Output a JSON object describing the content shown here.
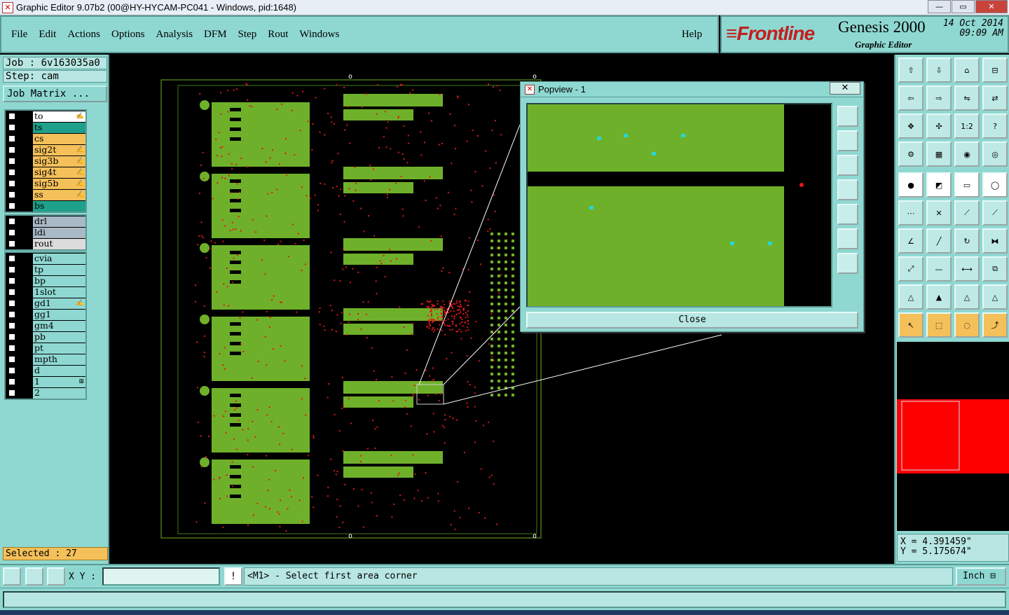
{
  "window": {
    "title": "Graphic Editor 9.07b2 (00@HY-HYCAM-PC041 - Windows, pid:1648)",
    "minimize": "—",
    "maximize": "▭",
    "close": "✕"
  },
  "menu": {
    "items": [
      "File",
      "Edit",
      "Actions",
      "Options",
      "Analysis",
      "DFM",
      "Step",
      "Rout",
      "Windows"
    ],
    "help": "Help"
  },
  "brand": {
    "logo": "≡Frontline",
    "product": "Genesis 2000",
    "subtitle": "Graphic Editor",
    "date": "14 Oct 2014",
    "time": "09:09 AM"
  },
  "job": {
    "job_label": "Job : 6v163035a0",
    "step_label": "Step: cam",
    "matrix_button": "Job Matrix ..."
  },
  "layers_group1": [
    {
      "name": "to",
      "color": "#ffffff",
      "mark": "✍"
    },
    {
      "name": "ts",
      "color": "#1fa08a",
      "mark": ""
    },
    {
      "name": "cs",
      "color": "#f4c05a",
      "mark": ""
    },
    {
      "name": "sig2t",
      "color": "#f4c05a",
      "mark": "✍"
    },
    {
      "name": "sig3b",
      "color": "#f4c05a",
      "mark": "✍"
    },
    {
      "name": "sig4t",
      "color": "#f4c05a",
      "mark": "✍"
    },
    {
      "name": "sig5b",
      "color": "#f4c05a",
      "mark": "✍"
    },
    {
      "name": "ss",
      "color": "#f4c05a",
      "mark": "✍"
    },
    {
      "name": "bs",
      "color": "#1fa08a",
      "mark": ""
    }
  ],
  "layers_group2": [
    {
      "name": "drl",
      "color": "#a9b9c5",
      "mark": ""
    },
    {
      "name": "ldi",
      "color": "#a9b9c5",
      "mark": ""
    },
    {
      "name": "rout",
      "color": "#dcdcdc",
      "mark": ""
    }
  ],
  "layers_group3": [
    {
      "name": "cvia",
      "color": "#8fd8d2",
      "mark": ""
    },
    {
      "name": "tp",
      "color": "#8fd8d2",
      "mark": ""
    },
    {
      "name": "bp",
      "color": "#8fd8d2",
      "mark": ""
    },
    {
      "name": "1slot",
      "color": "#8fd8d2",
      "mark": ""
    },
    {
      "name": "gd1",
      "color": "#8fd8d2",
      "mark": "✍"
    },
    {
      "name": "gg1",
      "color": "#8fd8d2",
      "mark": ""
    },
    {
      "name": "gm4",
      "color": "#8fd8d2",
      "mark": ""
    },
    {
      "name": "pb",
      "color": "#8fd8d2",
      "mark": ""
    },
    {
      "name": "pt",
      "color": "#8fd8d2",
      "mark": ""
    },
    {
      "name": "mpth",
      "color": "#8fd8d2",
      "mark": ""
    },
    {
      "name": "d",
      "color": "#8fd8d2",
      "mark": ""
    },
    {
      "name": "1",
      "color": "#8fd8d2",
      "mark": "⊞"
    },
    {
      "name": "2",
      "color": "#8fd8d2",
      "mark": ""
    }
  ],
  "selected": "Selected : 27",
  "popview": {
    "title": "Popview - 1",
    "close_x": "✕",
    "close_button": "Close"
  },
  "toolbar_right": {
    "one_to_two": "1:2",
    "help": "?"
  },
  "coords": {
    "x": "X = 4.391459\"",
    "y": "Y = 5.175674\""
  },
  "bottom": {
    "xy_label": "X Y :",
    "xy_value": "",
    "warn": "!",
    "message": "<M1> - Select first area corner",
    "units": "Inch ⊟"
  },
  "colors": {
    "panel": "#8fd8d2",
    "copper": "#6fb02a",
    "pads": "#e01818",
    "highlight": "#26d6d6"
  }
}
